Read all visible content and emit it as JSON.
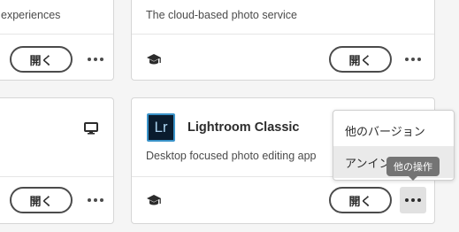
{
  "cards": [
    {
      "id": "top-left",
      "description": "experiences",
      "open_label": "開く"
    },
    {
      "id": "top-right",
      "description": "The cloud-based photo service",
      "open_label": "開く"
    },
    {
      "id": "bottom-left",
      "open_label": "開く"
    },
    {
      "id": "lightroom-classic",
      "logo_text": "Lr",
      "title": "Lightroom Classic",
      "description": "Desktop focused photo editing app",
      "open_label": "開く"
    }
  ],
  "context_menu": {
    "items": [
      "他のバージョン",
      "アンインストール"
    ]
  },
  "tooltip": "他の操作",
  "icons": {
    "learn": "graduation-cap-icon",
    "desktop": "monitor-icon",
    "more": "more-ellipsis-icon"
  },
  "colors": {
    "lightroom_bg": "#0a1c2e",
    "lightroom_accent": "#3a93c9",
    "tooltip_bg": "#747474"
  }
}
